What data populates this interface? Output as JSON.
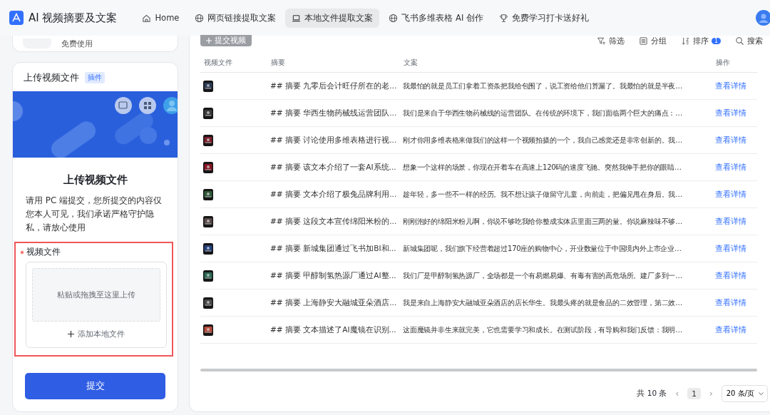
{
  "app": {
    "title": "AI 视频摘要及文案"
  },
  "nav": [
    {
      "label": "Home",
      "selected": false
    },
    {
      "label": "网页链接提取文案",
      "selected": false
    },
    {
      "label": "本地文件提取文案",
      "selected": true
    },
    {
      "label": "飞书多维表格 AI 创作",
      "selected": false
    },
    {
      "label": "免费学习打卡送好礼",
      "selected": false
    }
  ],
  "promo_card": {
    "text": "免费使用"
  },
  "upload_card": {
    "title": "上传视频文件",
    "badge": "插件",
    "heading": "上传视频文件",
    "description": "请用 PC 端提交，您所提交的内容仅您本人可见，我们承诺严格守护隐私，请放心使用",
    "field": {
      "label": "视频文件",
      "required": true,
      "dropzone": "粘贴或拖拽至这里上传",
      "add_button": "添加本地文件"
    },
    "submit": "提交"
  },
  "toolbar": {
    "add_button": {
      "label": "提交视频",
      "disabled": true
    },
    "actions": [
      {
        "label": "筛选"
      },
      {
        "label": "分组"
      },
      {
        "label": "排序",
        "badge": "1"
      },
      {
        "label": "搜索"
      }
    ]
  },
  "table": {
    "columns": [
      "视频文件",
      "摘要",
      "文案",
      "操作"
    ],
    "rows": [
      {
        "summary": "## 摘要 九零后会计旺仔所在的老...",
        "copy": "我最怕的就是员工们拿着工资条把我给包围了，说工资给他们算漏了。我最怕的就是半夜…",
        "action": "查看详情"
      },
      {
        "summary": "## 摘要 华西生物药械线运营团队...",
        "copy": "我们是来自于华西生物药械线的运营团队。在传统的环境下，我们面临两个巨大的痛点：…",
        "action": "查看详情"
      },
      {
        "summary": "## 摘要 讨论使用多维表格进行视...",
        "copy": "刚才你用多维表格来做我们的这样一个视频拍摄的一个，我自己感觉还是非常创新的。我…",
        "action": "查看详情"
      },
      {
        "summary": "## 摘要 该文本介绍了一套AI系统...",
        "copy": "想象一个这样的场景，你现在开着车在高速上120码的速度飞驰。突然我伸手把你的眼睛…",
        "action": "查看详情"
      },
      {
        "summary": "## 摘要 文本介绍了极兔品牌利用...",
        "copy": "趁年轻，多一些不一样的经历。我不想让孩子做留守儿童，向前走，把偏见甩在身后。我…",
        "action": "查看详情"
      },
      {
        "summary": "## 摘要 这段文本宣传绵阳米粉的...",
        "copy": "刚刚泡好的绵阳米粉儿啊，你说不够吃我给你整成实体店里面三两的量。你说麻辣味不够…",
        "action": "查看详情"
      },
      {
        "summary": "## 摘要 新城集团通过飞书加BI和...",
        "copy": "新城集团呢，我们旗下经营着超过170座的购物中心，开业数量位于中国境内外上市企业…",
        "action": "查看详情"
      },
      {
        "summary": "## 摘要 甲醇制氢热源厂通过AI整...",
        "copy": "我们厂是甲醇制氢热源厂，全场都是一个有易燃易爆、有毒有害的高危场所。建厂多到一…",
        "action": "查看详情"
      },
      {
        "summary": "## 摘要 上海静安大融城亚朵酒店...",
        "copy": "我是来自上海静安大融城亚朵酒店的店长华生。我最头疼的就是食品的二效管理，第二效…",
        "action": "查看详情"
      },
      {
        "summary": "## 摘要 文本描述了AI魔镜在识别...",
        "copy": "这面魔镜并非生来就完美，它也需要学习和成长。在测试阶段，有导购和我们反馈：我明…",
        "action": "查看详情"
      }
    ]
  },
  "pagination": {
    "total": "共 10 条",
    "prev": "‹",
    "pages": [
      {
        "label": "1",
        "selected": true
      }
    ],
    "next": "›",
    "page_size": "20 条/页"
  }
}
